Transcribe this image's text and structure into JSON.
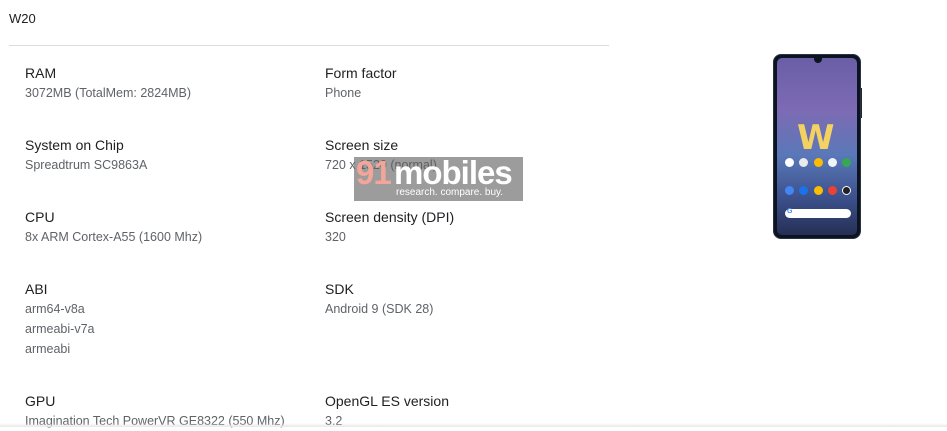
{
  "device": {
    "title": "W20"
  },
  "specs": {
    "ram": {
      "label": "RAM",
      "values": [
        "3072MB (TotalMem: 2824MB)"
      ]
    },
    "form_factor": {
      "label": "Form factor",
      "values": [
        "Phone"
      ]
    },
    "soc": {
      "label": "System on Chip",
      "values": [
        "Spreadtrum SC9863A"
      ]
    },
    "screen_size": {
      "label": "Screen size",
      "values": [
        "720 x 1520 (normal)"
      ]
    },
    "cpu": {
      "label": "CPU",
      "values": [
        "8x ARM Cortex-A55 (1600 Mhz)"
      ]
    },
    "density": {
      "label": "Screen density (DPI)",
      "values": [
        "320"
      ]
    },
    "abi": {
      "label": "ABI",
      "values": [
        "arm64-v8a",
        "armeabi-v7a",
        "armeabi"
      ]
    },
    "sdk": {
      "label": "SDK",
      "values": [
        "Android 9 (SDK 28)"
      ]
    },
    "gpu": {
      "label": "GPU",
      "values": [
        "Imagination Tech PowerVR GE8322 (550 Mhz)"
      ]
    },
    "opengl": {
      "label": "OpenGL ES version",
      "values": [
        "3.2"
      ]
    }
  },
  "watermark": {
    "brand_number": "91",
    "brand_name": "mobiles",
    "tagline": "research. compare. buy."
  },
  "phone_image": {
    "logo_letter": "W",
    "search_glyph": "G"
  }
}
